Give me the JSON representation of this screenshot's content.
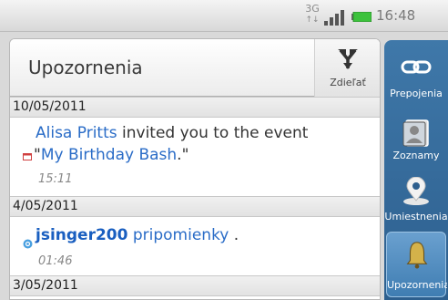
{
  "status_bar": {
    "network_type": "3G",
    "time": "16:48"
  },
  "header": {
    "title": "Upozornenia",
    "share_label": "Zdieľať"
  },
  "notifications": [
    {
      "date": "10/05/2011",
      "actor": "Alisa Pritts",
      "text_mid": " invited you to the event",
      "quote_open": "\"",
      "event_name": "My Birthday Bash",
      "quote_close": ".\"",
      "time": "15:11"
    },
    {
      "date": "4/05/2011",
      "actor": "jsinger200",
      "text_mid": " pripomienky",
      "text_end": " .",
      "time": "01:46"
    }
  ],
  "next_date": "3/05/2011",
  "tabs": [
    {
      "label": "Prepojenia",
      "icon": "link-icon"
    },
    {
      "label": "Zoznamy",
      "icon": "contacts-icon"
    },
    {
      "label": "Umiestnenia",
      "icon": "location-pin-icon"
    },
    {
      "label": "Upozornenia",
      "icon": "bell-icon",
      "active": true
    }
  ],
  "colors": {
    "link": "#2a6cc7",
    "rail": "#3f78a9",
    "battery": "#3cc23c"
  }
}
